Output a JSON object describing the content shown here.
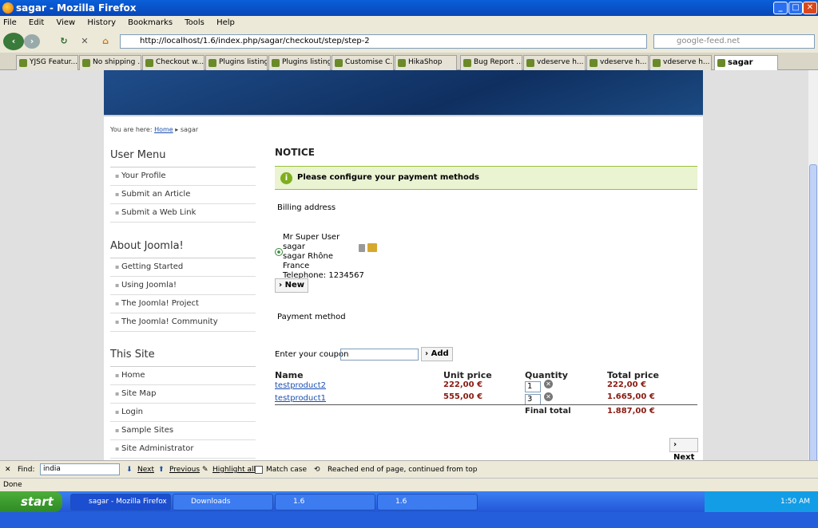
{
  "window": {
    "title": "sagar - Mozilla Firefox"
  },
  "menu": [
    "File",
    "Edit",
    "View",
    "History",
    "Bookmarks",
    "Tools",
    "Help"
  ],
  "url": "http://localhost/1.6/index.php/sagar/checkout/step/step-2",
  "search_placeholder": "google-feed.net",
  "tabs": [
    "YJSG Featur...",
    "No shipping ...",
    "Checkout w...",
    "Plugins listing",
    "Plugins listing",
    "Customise C...",
    "HikaShop",
    "Bug Report ...",
    "vdeserve h...",
    "vdeserve h...",
    "vdeserve h...",
    "sagar"
  ],
  "breadcrumb": {
    "prefix": "You are here:",
    "home": "Home",
    "current": "sagar"
  },
  "sidebar": {
    "user_menu": {
      "title": "User Menu",
      "items": [
        "Your Profile",
        "Submit an Article",
        "Submit a Web Link"
      ]
    },
    "about": {
      "title": "About Joomla!",
      "items": [
        "Getting Started",
        "Using Joomla!",
        "The Joomla! Project",
        "The Joomla! Community"
      ]
    },
    "site": {
      "title": "This Site",
      "items": [
        "Home",
        "Site Map",
        "Login",
        "Sample Sites",
        "Site Administrator"
      ]
    }
  },
  "notice": {
    "title": "NOTICE",
    "message": "Please configure your payment methods"
  },
  "billing": {
    "label": "Billing address",
    "name": "Mr Super User",
    "line1": "sagar",
    "line2": "sagar Rhône",
    "country": "France",
    "phone": "Telephone: 1234567",
    "new_btn": "New"
  },
  "payment": {
    "label": "Payment method"
  },
  "coupon": {
    "label": "Enter your coupon",
    "add_btn": "Add"
  },
  "cart": {
    "headers": {
      "name": "Name",
      "unit": "Unit price",
      "qty": "Quantity",
      "total": "Total price"
    },
    "rows": [
      {
        "name": "testproduct2",
        "unit": "222,00 €",
        "qty": "1",
        "total": "222,00 €"
      },
      {
        "name": "testproduct1",
        "unit": "555,00 €",
        "qty": "3",
        "total": "1.665,00 €"
      }
    ],
    "final_label": "Final total",
    "final_value": "1.887,00 €"
  },
  "next_btn": "Next",
  "find": {
    "label": "Find:",
    "value": "india",
    "next": "Next",
    "previous": "Previous",
    "highlight": "Highlight all",
    "match": "Match case",
    "status": "Reached end of page, continued from top"
  },
  "status": "Done",
  "taskbar": {
    "start": "start",
    "items": [
      "sagar - Mozilla Firefox",
      "Downloads",
      "1.6",
      "1.6"
    ],
    "clock": "1:50 AM"
  }
}
